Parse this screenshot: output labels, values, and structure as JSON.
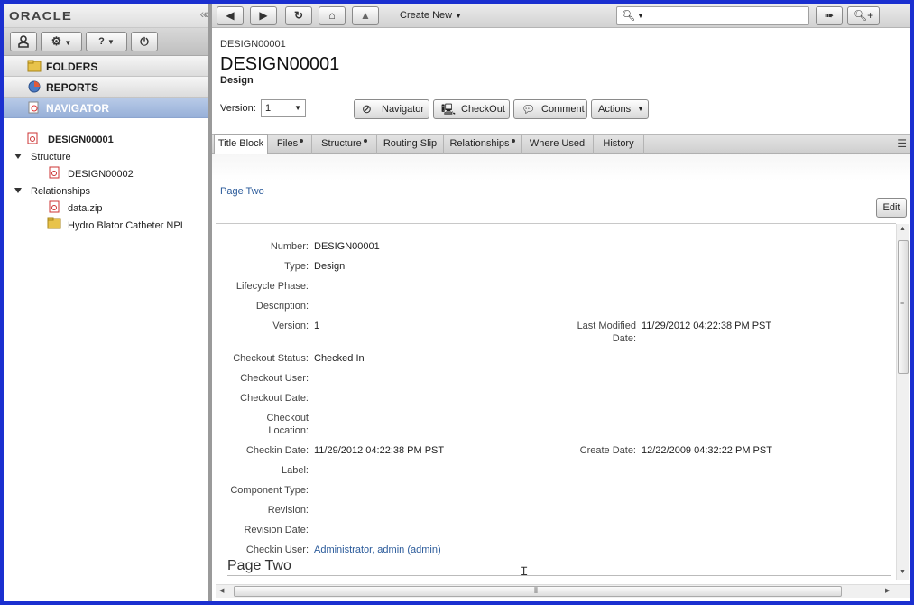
{
  "brand": {
    "logo": "ORACLE"
  },
  "left_nav": {
    "sections": [
      {
        "label": "FOLDERS"
      },
      {
        "label": "REPORTS"
      },
      {
        "label": "NAVIGATOR"
      }
    ],
    "tree": {
      "root": "DESIGN00001",
      "structure_label": "Structure",
      "structure_child": "DESIGN00002",
      "relationships_label": "Relationships",
      "rel_child_1": "data.zip",
      "rel_child_2": "Hydro Blator Catheter NPI"
    }
  },
  "toolbar": {
    "create_new": "Create New",
    "help_glyph": "?"
  },
  "object": {
    "breadcrumb": "DESIGN00001",
    "title": "DESIGN00001",
    "subtitle": "Design",
    "version_label": "Version:",
    "version_value": "1"
  },
  "actions": {
    "navigator": "Navigator",
    "checkout": "CheckOut",
    "comment": "Comment",
    "actions": "Actions"
  },
  "tabs": [
    "Title Block",
    "Files",
    "Structure",
    "Routing Slip",
    "Relationships",
    "Where Used",
    "History"
  ],
  "page": {
    "page_two_link": "Page Two",
    "edit": "Edit",
    "page_two_heading": "Page Two"
  },
  "fields": {
    "number": {
      "label": "Number:",
      "value": "DESIGN00001"
    },
    "type": {
      "label": "Type:",
      "value": "Design"
    },
    "lifecycle": {
      "label": "Lifecycle Phase:",
      "value": ""
    },
    "description": {
      "label": "Description:",
      "value": ""
    },
    "version": {
      "label": "Version:",
      "value": "1"
    },
    "last_modified": {
      "label_1": "Last Modified",
      "label_2": "Date:",
      "value": "11/29/2012 04:22:38 PM PST"
    },
    "checkout_status": {
      "label": "Checkout Status:",
      "value": "Checked In"
    },
    "checkout_user": {
      "label": "Checkout User:",
      "value": ""
    },
    "checkout_date": {
      "label": "Checkout Date:",
      "value": ""
    },
    "checkout_location": {
      "label_1": "Checkout",
      "label_2": "Location:",
      "value": ""
    },
    "checkin_date": {
      "label": "Checkin Date:",
      "value": "11/29/2012 04:22:38 PM PST"
    },
    "create_date": {
      "label": "Create Date:",
      "value": "12/22/2009 04:32:22 PM PST"
    },
    "label": {
      "label": "Label:",
      "value": ""
    },
    "component_type": {
      "label": "Component Type:",
      "value": ""
    },
    "revision": {
      "label": "Revision:",
      "value": ""
    },
    "revision_date": {
      "label": "Revision Date:",
      "value": ""
    },
    "checkin_user": {
      "label": "Checkin User:",
      "value": "Administrator, admin (admin)"
    }
  },
  "colors": {
    "frame": "#1a2fd0",
    "active_nav": "#a7bde0",
    "link": "#2a5a9a"
  }
}
